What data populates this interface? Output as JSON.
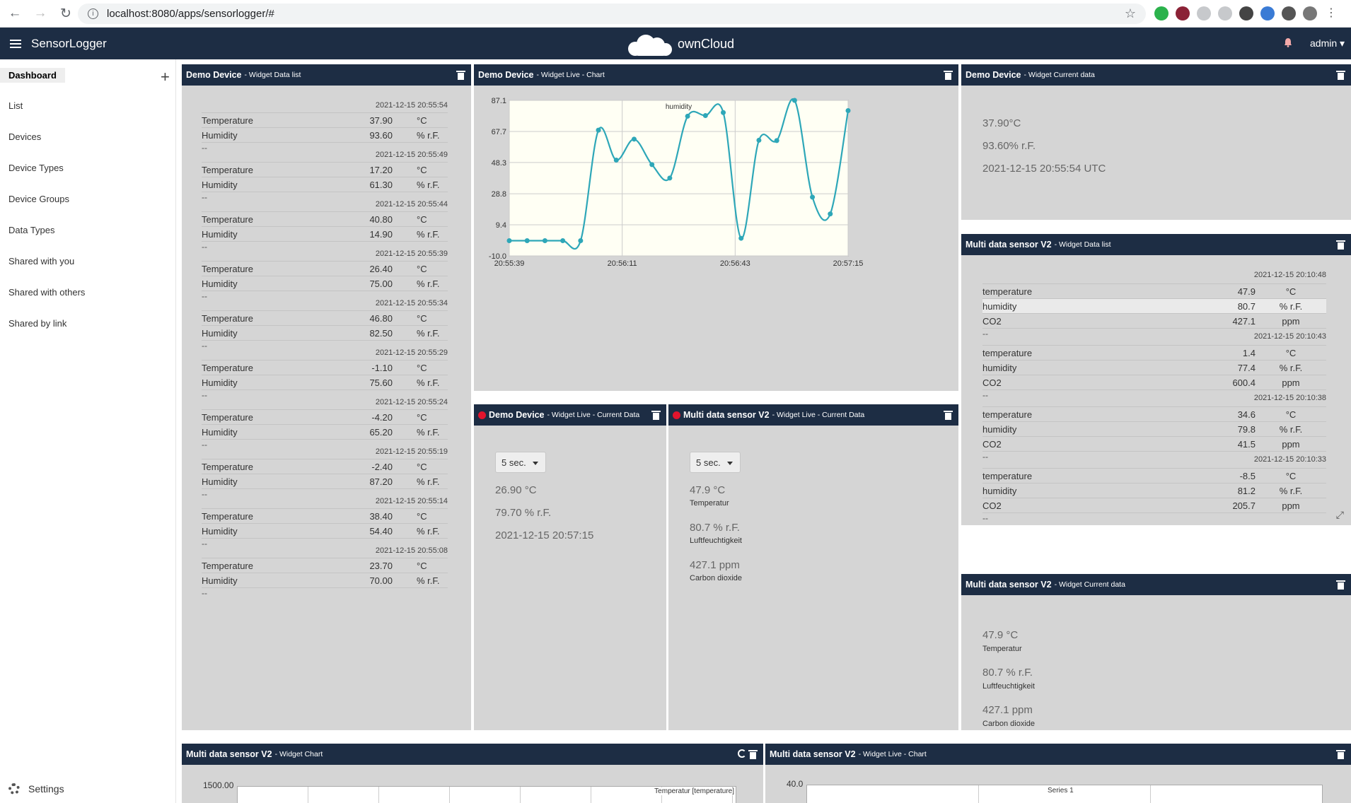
{
  "browser": {
    "url": "localhost:8080/apps/sensorlogger/#"
  },
  "app": {
    "title": "SensorLogger",
    "brand": "ownCloud",
    "user": "admin ▾"
  },
  "sidebar": {
    "items": [
      {
        "label": "Dashboard"
      },
      {
        "label": "List"
      },
      {
        "label": "Devices"
      },
      {
        "label": "Device Types"
      },
      {
        "label": "Device Groups"
      },
      {
        "label": "Data Types"
      },
      {
        "label": "Shared with you"
      },
      {
        "label": "Shared with others"
      },
      {
        "label": "Shared by link"
      }
    ],
    "settings_label": "Settings"
  },
  "widgets": {
    "demo_datalist": {
      "title": "Demo Device",
      "subtitle": "- Widget Data list",
      "separator": "--",
      "entries": [
        {
          "ts": "2021-12-15 20:55:54",
          "rows": [
            {
              "name": "Temperature",
              "value": "37.90",
              "unit": "°C"
            },
            {
              "name": "Humidity",
              "value": "93.60",
              "unit": "% r.F."
            }
          ]
        },
        {
          "ts": "2021-12-15 20:55:49",
          "rows": [
            {
              "name": "Temperature",
              "value": "17.20",
              "unit": "°C"
            },
            {
              "name": "Humidity",
              "value": "61.30",
              "unit": "% r.F."
            }
          ]
        },
        {
          "ts": "2021-12-15 20:55:44",
          "rows": [
            {
              "name": "Temperature",
              "value": "40.80",
              "unit": "°C"
            },
            {
              "name": "Humidity",
              "value": "14.90",
              "unit": "% r.F."
            }
          ]
        },
        {
          "ts": "2021-12-15 20:55:39",
          "rows": [
            {
              "name": "Temperature",
              "value": "26.40",
              "unit": "°C"
            },
            {
              "name": "Humidity",
              "value": "75.00",
              "unit": "% r.F."
            }
          ]
        },
        {
          "ts": "2021-12-15 20:55:34",
          "rows": [
            {
              "name": "Temperature",
              "value": "46.80",
              "unit": "°C"
            },
            {
              "name": "Humidity",
              "value": "82.50",
              "unit": "% r.F."
            }
          ]
        },
        {
          "ts": "2021-12-15 20:55:29",
          "rows": [
            {
              "name": "Temperature",
              "value": "-1.10",
              "unit": "°C"
            },
            {
              "name": "Humidity",
              "value": "75.60",
              "unit": "% r.F."
            }
          ]
        },
        {
          "ts": "2021-12-15 20:55:24",
          "rows": [
            {
              "name": "Temperature",
              "value": "-4.20",
              "unit": "°C"
            },
            {
              "name": "Humidity",
              "value": "65.20",
              "unit": "% r.F."
            }
          ]
        },
        {
          "ts": "2021-12-15 20:55:19",
          "rows": [
            {
              "name": "Temperature",
              "value": "-2.40",
              "unit": "°C"
            },
            {
              "name": "Humidity",
              "value": "87.20",
              "unit": "% r.F."
            }
          ]
        },
        {
          "ts": "2021-12-15 20:55:14",
          "rows": [
            {
              "name": "Temperature",
              "value": "38.40",
              "unit": "°C"
            },
            {
              "name": "Humidity",
              "value": "54.40",
              "unit": "% r.F."
            }
          ]
        },
        {
          "ts": "2021-12-15 20:55:08",
          "rows": [
            {
              "name": "Temperature",
              "value": "23.70",
              "unit": "°C"
            },
            {
              "name": "Humidity",
              "value": "70.00",
              "unit": "% r.F."
            }
          ]
        }
      ]
    },
    "demo_livechart": {
      "title": "Demo Device",
      "subtitle": "- Widget Live - Chart",
      "chart_data": {
        "type": "line",
        "series": [
          {
            "name": "humidity",
            "x": [
              "20:55:39",
              "20:55:44",
              "20:55:49",
              "20:55:54",
              "20:55:59",
              "20:56:03",
              "20:56:07",
              "20:56:11",
              "20:56:15",
              "20:56:19",
              "20:56:23",
              "20:56:27",
              "20:56:31",
              "20:56:35",
              "20:56:39",
              "20:56:43",
              "20:56:47",
              "20:56:51",
              "20:56:55",
              "20:56:59",
              "20:57:03",
              "20:57:07",
              "20:57:11",
              "20:57:15"
            ],
            "values": [
              -0.5,
              -0.5,
              -0.5,
              -0.5,
              -0.5,
              68.5,
              49.8,
              62.9,
              47.0,
              38.6,
              77.2,
              77.6,
              79.5,
              1.0,
              62.2,
              62.0,
              87.1,
              26.7,
              16.2,
              80.7
            ]
          }
        ],
        "x_ticks": [
          "20:55:39",
          "20:56:11",
          "20:56:43",
          "20:57:15"
        ],
        "y_ticks": [
          "87.1",
          "67.7",
          "48.3",
          "28.8",
          "9.4",
          "-10.0"
        ],
        "ylim": [
          -10.0,
          87.1
        ],
        "grid": true,
        "legend": "top-center"
      }
    },
    "demo_current": {
      "title": "Demo Device",
      "subtitle": "- Widget Current data",
      "temperature": "37.90°C",
      "humidity": "93.60% r.F.",
      "timestamp": "2021-12-15 20:55:54 UTC"
    },
    "demo_live_current": {
      "title": "Demo Device",
      "subtitle": "- Widget Live - Current Data",
      "interval": "5 sec.",
      "temperature": "26.90 °C",
      "humidity": "79.70 % r.F.",
      "timestamp": "2021-12-15 20:57:15"
    },
    "multi_live_current": {
      "title": "Multi data sensor V2",
      "subtitle": "- Widget Live - Current Data",
      "interval": "5 sec.",
      "items": [
        {
          "value": "47.9 °C",
          "label": "Temperatur"
        },
        {
          "value": "80.7 % r.F.",
          "label": "Luftfeuchtigkeit"
        },
        {
          "value": "427.1 ppm",
          "label": "Carbon dioxide"
        }
      ]
    },
    "multi_datalist": {
      "title": "Multi data sensor V2",
      "subtitle": "- Widget Data list",
      "separator": "--",
      "entries": [
        {
          "ts": "2021-12-15 20:10:48",
          "rows": [
            {
              "name": "temperature",
              "value": "47.9",
              "unit": "°C"
            },
            {
              "name": "humidity",
              "value": "80.7",
              "unit": "% r.F."
            },
            {
              "name": "CO2",
              "value": "427.1",
              "unit": "ppm"
            }
          ]
        },
        {
          "ts": "2021-12-15 20:10:43",
          "rows": [
            {
              "name": "temperature",
              "value": "1.4",
              "unit": "°C"
            },
            {
              "name": "humidity",
              "value": "77.4",
              "unit": "% r.F."
            },
            {
              "name": "CO2",
              "value": "600.4",
              "unit": "ppm"
            }
          ]
        },
        {
          "ts": "2021-12-15 20:10:38",
          "rows": [
            {
              "name": "temperature",
              "value": "34.6",
              "unit": "°C"
            },
            {
              "name": "humidity",
              "value": "79.8",
              "unit": "% r.F."
            },
            {
              "name": "CO2",
              "value": "41.5",
              "unit": "ppm"
            }
          ]
        },
        {
          "ts": "2021-12-15 20:10:33",
          "rows": [
            {
              "name": "temperature",
              "value": "-8.5",
              "unit": "°C"
            },
            {
              "name": "humidity",
              "value": "81.2",
              "unit": "% r.F."
            },
            {
              "name": "CO2",
              "value": "205.7",
              "unit": "ppm"
            }
          ]
        }
      ]
    },
    "multi_current": {
      "title": "Multi data sensor V2",
      "subtitle": "- Widget Current data",
      "items": [
        {
          "value": "47.9 °C",
          "label": "Temperatur"
        },
        {
          "value": "80.7 % r.F.",
          "label": "Luftfeuchtigkeit"
        },
        {
          "value": "427.1 ppm",
          "label": "Carbon dioxide"
        }
      ]
    },
    "multi_chart": {
      "title": "Multi data sensor V2",
      "subtitle": "- Widget Chart",
      "y_top_tick": "1500.00",
      "legend": "Temperatur [temperature]"
    },
    "multi_livechart": {
      "title": "Multi data sensor V2",
      "subtitle": "- Widget Live - Chart",
      "y_top_tick": "40.0",
      "legend": "Series 1"
    }
  },
  "colors": {
    "header": "#1d2d44",
    "widget_bg": "#d5d5d5",
    "chart_line": "#2ea7b8",
    "live_dot": "#e2142d"
  }
}
